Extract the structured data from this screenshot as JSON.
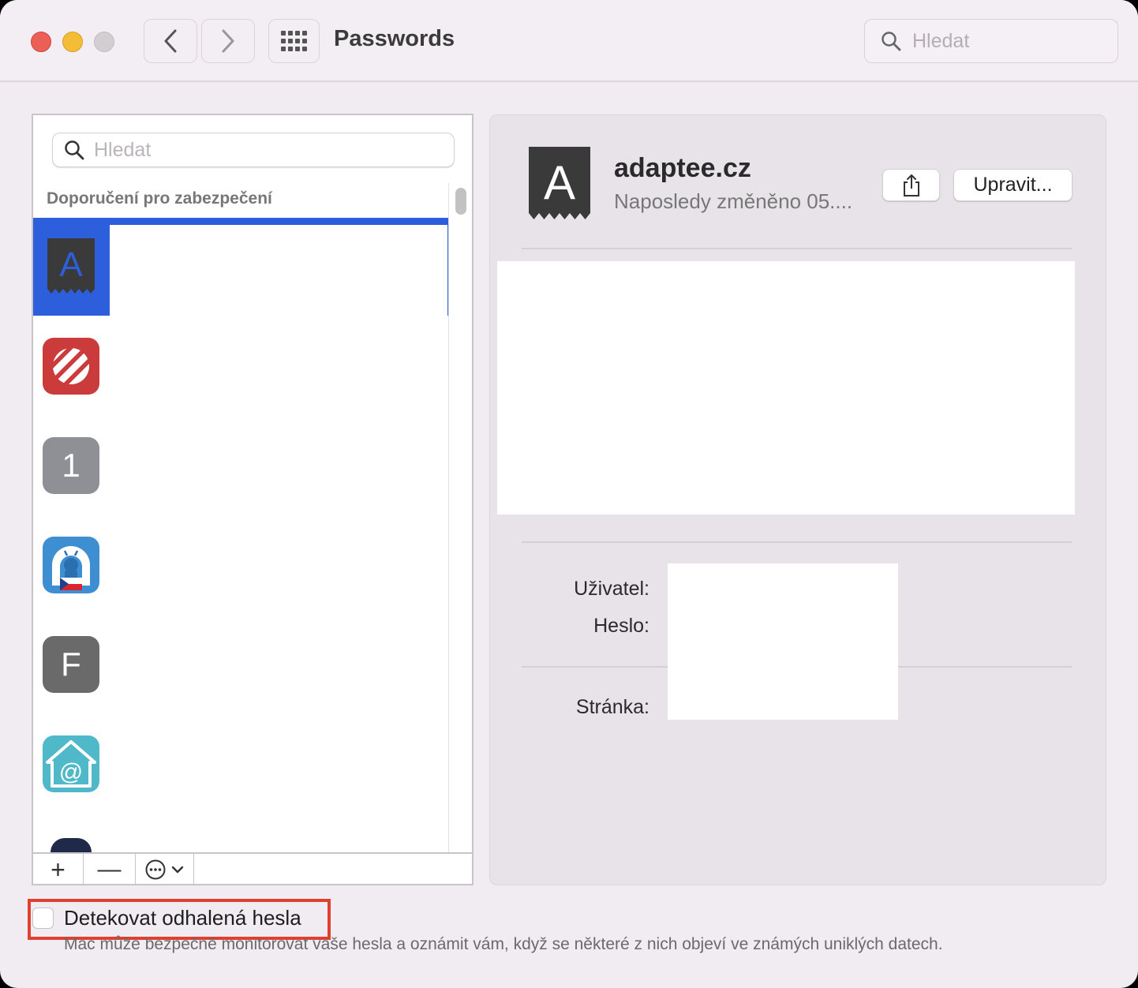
{
  "window": {
    "title": "Passwords",
    "search_placeholder": "Hledat"
  },
  "list": {
    "search_placeholder": "Hledat",
    "section_header": "Doporučení pro zabezpečení",
    "items": [
      {
        "icon": "letter-a-icon",
        "letter": "A",
        "color": "#3a3a3a",
        "selected": true
      },
      {
        "icon": "red-stripes-icon",
        "color": "#cc3b3b"
      },
      {
        "icon": "number-one-icon",
        "letter": "1",
        "color": "#8f8f96"
      },
      {
        "icon": "robot-flag-icon",
        "color": "#3d8fd1"
      },
      {
        "icon": "letter-f-icon",
        "letter": "F",
        "color": "#6a6a6a"
      },
      {
        "icon": "email-home-icon",
        "color": "#4fb8c9"
      }
    ],
    "toolbar": {
      "add": "+",
      "remove": "—"
    }
  },
  "detail": {
    "site": "adaptee.cz",
    "changed": "Naposledy změněno 05....",
    "edit_label": "Upravit...",
    "user_label": "Uživatel:",
    "password_label": "Heslo:",
    "website_label": "Stránka:"
  },
  "footer": {
    "checkbox_label": "Detekovat odhalená hesla",
    "description": "Mac může bezpečně monitorovat vaše hesla a oznámit vám, když se některé z nich objeví ve známých uniklých datech."
  },
  "colors": {
    "selection": "#2d5fdc",
    "highlight_frame": "#e0402f"
  }
}
